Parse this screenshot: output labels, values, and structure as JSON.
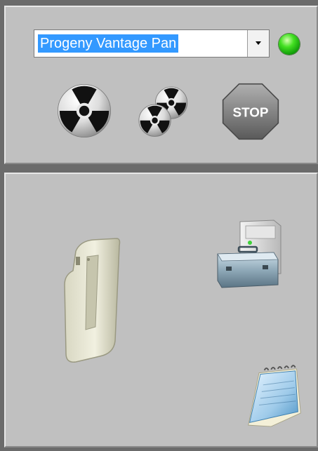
{
  "device_selector": {
    "value": "Progeny Vantage Pan",
    "arrow_icon": "chevron-down-icon"
  },
  "status_led": {
    "color": "#2ecc1a",
    "icon": "green-status-led"
  },
  "actions": {
    "single_exposure_icon": "radiation-icon",
    "multi_exposure_icon": "multi-radiation-icon",
    "stop_label": "STOP"
  },
  "tools": {
    "scanner_icon": "xray-sensor-icon",
    "service_icon": "toolbox-computer-icon",
    "notes_icon": "notepad-icon"
  }
}
